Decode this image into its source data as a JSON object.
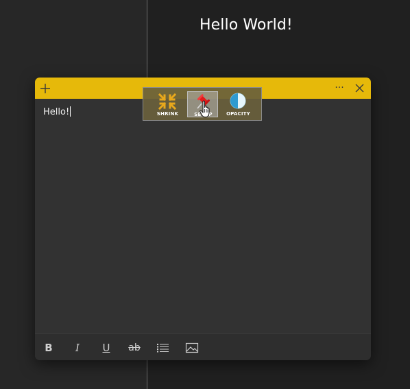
{
  "background": {
    "title": "Hello World!"
  },
  "note": {
    "header_color": "#e6b90a",
    "body_text": "Hello!",
    "icons": {
      "add": "plus-icon",
      "more": "more-horizontal-icon",
      "close": "close-icon"
    },
    "more_glyph": "···"
  },
  "toolbar_popup": {
    "buttons": [
      {
        "label": "SHRINK",
        "icon": "shrink-arrows-icon"
      },
      {
        "label": "SETUP",
        "icon": "pin-icon"
      },
      {
        "label": "OPACITY",
        "icon": "opacity-half-circle-icon"
      }
    ]
  },
  "footer": {
    "bold": "B",
    "italic": "I",
    "underline": "U",
    "strikethrough": "ab",
    "icons": {
      "list": "bullet-list-icon",
      "image": "image-icon"
    }
  }
}
